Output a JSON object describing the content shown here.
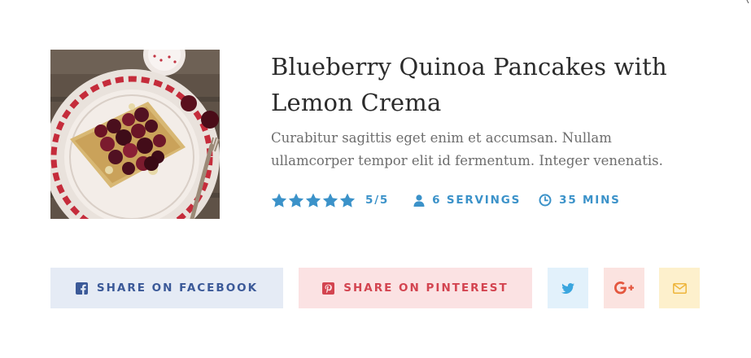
{
  "recipe": {
    "title": "Blueberry Quinoa Pancakes with Lemon Crema",
    "description": "Curabitur sagittis eget enim et accumsan. Nullam ullamcorper tempor elit id fermentum. Integer venenatis.",
    "photo_icon": "pancakes-photo",
    "rating": {
      "stars_filled": 5,
      "stars_total": 5,
      "text": "5/5",
      "icon": "star-icon"
    },
    "servings": {
      "icon": "user-icon",
      "text": "6 SERVINGS"
    },
    "time": {
      "icon": "clock-icon",
      "text": "35 MINS"
    },
    "accent_color": "#3b92c9"
  },
  "share": {
    "facebook": {
      "label": "SHARE ON FACEBOOK",
      "icon": "facebook-square-icon",
      "color": "#3b5998",
      "bg": "#e5ebf5"
    },
    "pinterest": {
      "label": "SHARE ON PINTEREST",
      "icon": "pinterest-square-icon",
      "color": "#d34450",
      "bg": "#fbe2e3"
    },
    "twitter": {
      "icon": "twitter-icon",
      "color": "#3aa6df",
      "bg": "#e2f1fb"
    },
    "google_plus": {
      "icon": "google-plus-icon",
      "color": "#e4573f",
      "bg": "#fbe3e0"
    },
    "email": {
      "icon": "envelope-icon",
      "color": "#eeb53b",
      "bg": "#fdf0cc"
    }
  }
}
